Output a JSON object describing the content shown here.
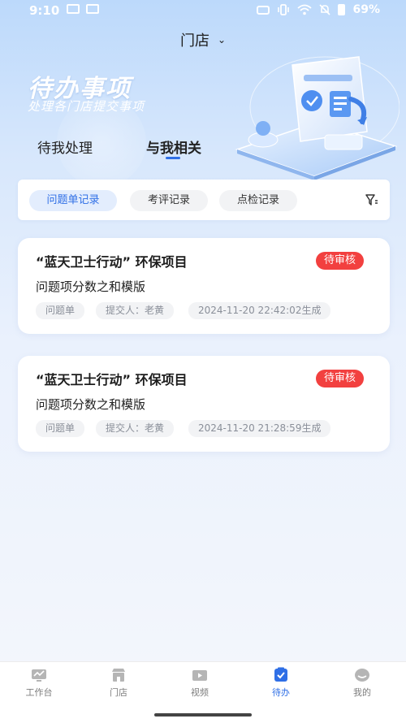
{
  "status_bar": {
    "time": "9:10",
    "battery": "69%"
  },
  "header": {
    "store_label": "门店"
  },
  "hero": {
    "title": "待办事项",
    "subtitle": "处理各门店提交事项"
  },
  "tabs": [
    {
      "label": "待我处理",
      "active": false
    },
    {
      "label": "与我相关",
      "active": true
    }
  ],
  "filters": [
    {
      "label": "问题单记录",
      "active": true
    },
    {
      "label": "考评记录",
      "active": false
    },
    {
      "label": "点检记录",
      "active": false
    }
  ],
  "cards": [
    {
      "title": "“蓝天卫士行动” 环保项目",
      "status": "待审核",
      "subtitle": "问题项分数之和模版",
      "type": "问题单",
      "submitter": "提交人：老黄",
      "time": "2024-11-20 22:42:02生成"
    },
    {
      "title": "“蓝天卫士行动” 环保项目",
      "status": "待审核",
      "subtitle": "问题项分数之和模版",
      "type": "问题单",
      "submitter": "提交人：老黄",
      "time": "2024-11-20 21:28:59生成"
    }
  ],
  "bottom_nav": [
    {
      "label": "工作台",
      "icon": "workbench-icon",
      "active": false
    },
    {
      "label": "门店",
      "icon": "store-icon",
      "active": false
    },
    {
      "label": "视频",
      "icon": "video-icon",
      "active": false
    },
    {
      "label": "待办",
      "icon": "todo-icon",
      "active": true
    },
    {
      "label": "我的",
      "icon": "profile-icon",
      "active": false
    }
  ],
  "colors": {
    "accent": "#2f6fe6",
    "badge": "#f2403f",
    "nav_inactive": "#b5b5b5"
  }
}
